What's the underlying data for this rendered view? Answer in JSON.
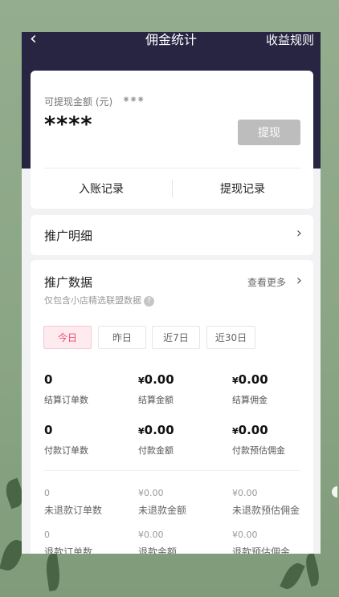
{
  "nav": {
    "back_icon": "chevron-left-icon",
    "title": "佣金统计",
    "rules": "收益规则"
  },
  "balance": {
    "label": "可提现金额 (元)",
    "eye_icon": "eye-closed-icon",
    "masked_amount": "****",
    "withdraw_button": "提现",
    "entry_records": "入账记录",
    "withdraw_records": "提现记录"
  },
  "promo_detail": {
    "title": "推广明细"
  },
  "promo_data": {
    "title": "推广数据",
    "more": "查看更多",
    "note": "仅包含小店精选联盟数据",
    "help_icon": "?",
    "tabs": [
      "今日",
      "昨日",
      "近7日",
      "近30日"
    ],
    "active_tab": "今日",
    "primary": [
      {
        "value": "0",
        "currency": "",
        "label": "结算订单数"
      },
      {
        "value": "0.00",
        "currency": "¥",
        "label": "结算金额"
      },
      {
        "value": "0.00",
        "currency": "¥",
        "label": "结算佣金"
      },
      {
        "value": "0",
        "currency": "",
        "label": "付款订单数"
      },
      {
        "value": "0.00",
        "currency": "¥",
        "label": "付款金额"
      },
      {
        "value": "0.00",
        "currency": "¥",
        "label": "付款预估佣金"
      }
    ],
    "secondary": [
      {
        "value": "0",
        "label": "未退款订单数"
      },
      {
        "value": "¥0.00",
        "label": "未退款金额"
      },
      {
        "value": "¥0.00",
        "label": "未退款预估佣金"
      },
      {
        "value": "0",
        "label": "退款订单数"
      },
      {
        "value": "¥0.00",
        "label": "退款金额"
      },
      {
        "value": "¥0.00",
        "label": "退款预估佣金"
      }
    ]
  },
  "colors": {
    "header": "#272542",
    "accent": "#f04a6a",
    "button_disabled": "#bdbdbd",
    "wallpaper": "#8fa98a"
  }
}
